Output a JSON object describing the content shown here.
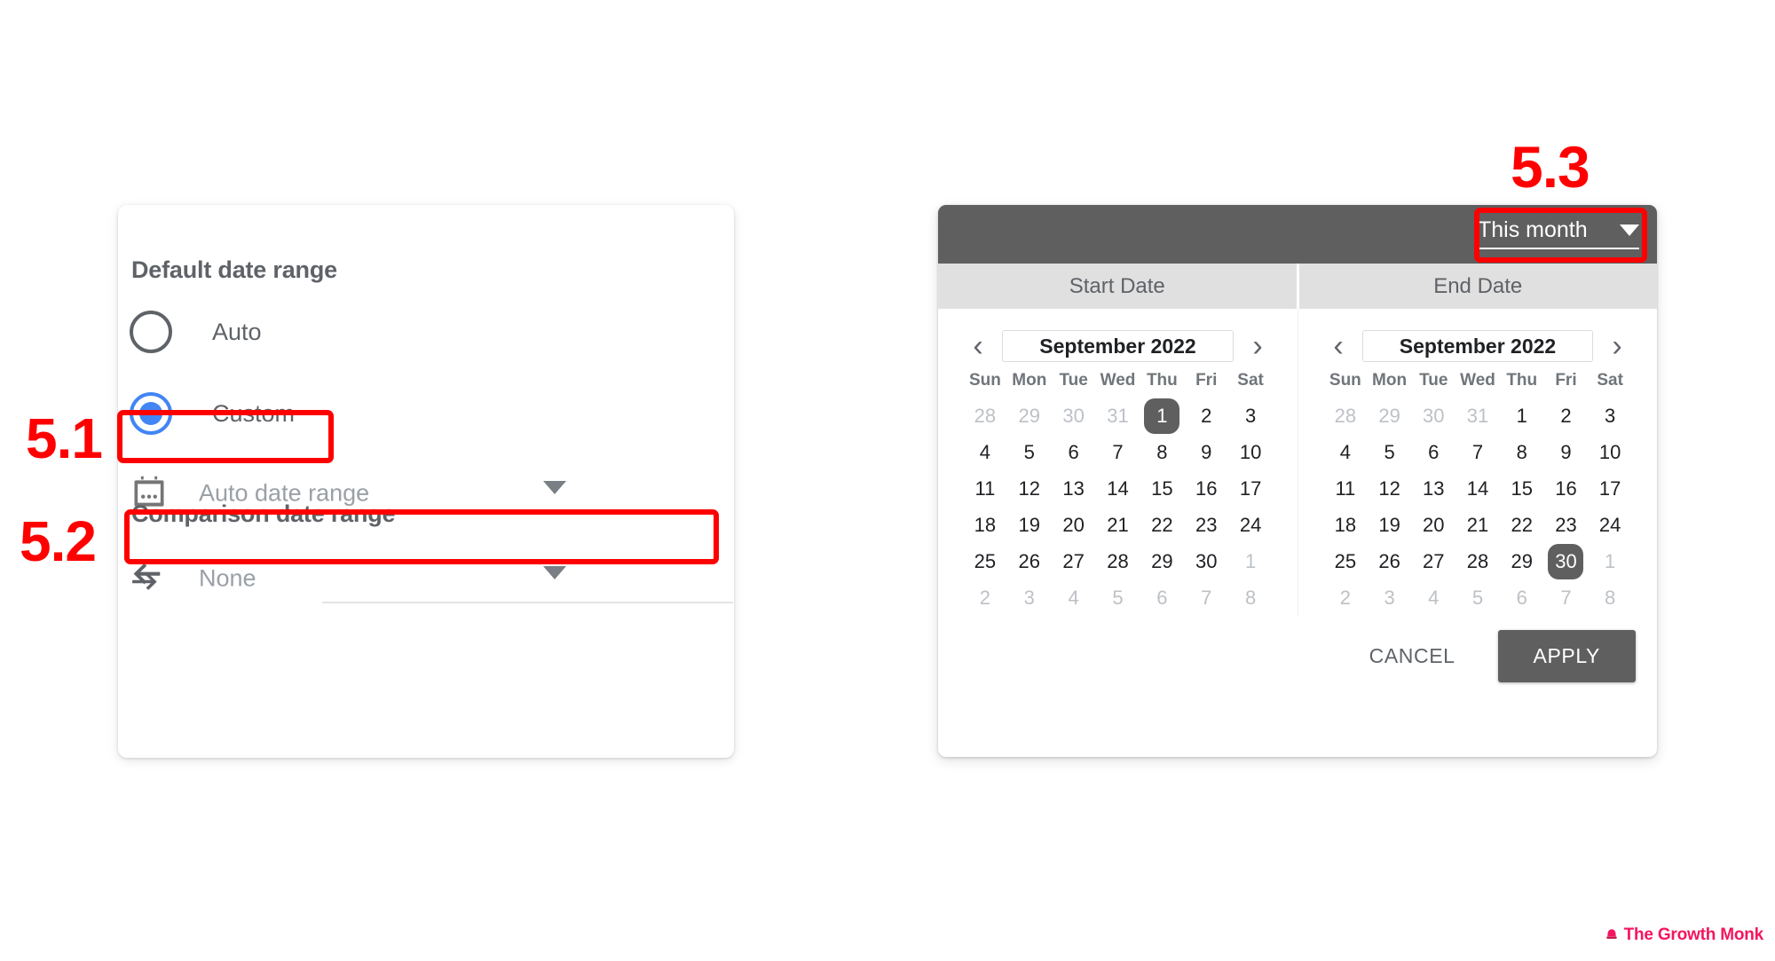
{
  "left_card": {
    "section_title_default": "Default date range",
    "section_title_comparison": "Comparison date range",
    "radio_auto_label": "Auto",
    "radio_custom_label": "Custom",
    "date_range_field_value": "Auto date range",
    "comparison_field_value": "None",
    "radio_selected": "Custom",
    "accent_color": "#4285f4",
    "text_color": "#5f6368"
  },
  "right_panel": {
    "preset_label": "This month",
    "tab_start": "Start Date",
    "tab_end": "End Date",
    "cancel_label": "CANCEL",
    "apply_label": "APPLY",
    "header_color": "#5f5f5f",
    "tab_bg_color": "#e0e0e0",
    "start_calendar": {
      "month_label": "September 2022",
      "prev_icon": "chevron-left-icon",
      "next_icon": "chevron-right-icon",
      "dow": [
        "Sun",
        "Mon",
        "Tue",
        "Wed",
        "Thu",
        "Fri",
        "Sat"
      ],
      "weeks": [
        [
          {
            "d": "28",
            "muted": true
          },
          {
            "d": "29",
            "muted": true
          },
          {
            "d": "30",
            "muted": true
          },
          {
            "d": "31",
            "muted": true
          },
          {
            "d": "1",
            "sel": true
          },
          {
            "d": "2"
          },
          {
            "d": "3"
          }
        ],
        [
          {
            "d": "4"
          },
          {
            "d": "5"
          },
          {
            "d": "6"
          },
          {
            "d": "7"
          },
          {
            "d": "8"
          },
          {
            "d": "9"
          },
          {
            "d": "10"
          }
        ],
        [
          {
            "d": "11"
          },
          {
            "d": "12"
          },
          {
            "d": "13"
          },
          {
            "d": "14"
          },
          {
            "d": "15"
          },
          {
            "d": "16"
          },
          {
            "d": "17"
          }
        ],
        [
          {
            "d": "18"
          },
          {
            "d": "19"
          },
          {
            "d": "20"
          },
          {
            "d": "21"
          },
          {
            "d": "22"
          },
          {
            "d": "23"
          },
          {
            "d": "24"
          }
        ],
        [
          {
            "d": "25"
          },
          {
            "d": "26"
          },
          {
            "d": "27"
          },
          {
            "d": "28"
          },
          {
            "d": "29"
          },
          {
            "d": "30"
          },
          {
            "d": "1",
            "muted": true
          }
        ],
        [
          {
            "d": "2",
            "muted": true
          },
          {
            "d": "3",
            "muted": true
          },
          {
            "d": "4",
            "muted": true
          },
          {
            "d": "5",
            "muted": true
          },
          {
            "d": "6",
            "muted": true
          },
          {
            "d": "7",
            "muted": true
          },
          {
            "d": "8",
            "muted": true
          }
        ]
      ],
      "selected_day": "1"
    },
    "end_calendar": {
      "month_label": "September 2022",
      "prev_icon": "chevron-left-icon",
      "next_icon": "chevron-right-icon",
      "dow": [
        "Sun",
        "Mon",
        "Tue",
        "Wed",
        "Thu",
        "Fri",
        "Sat"
      ],
      "weeks": [
        [
          {
            "d": "28",
            "muted": true
          },
          {
            "d": "29",
            "muted": true
          },
          {
            "d": "30",
            "muted": true
          },
          {
            "d": "31",
            "muted": true
          },
          {
            "d": "1"
          },
          {
            "d": "2"
          },
          {
            "d": "3"
          }
        ],
        [
          {
            "d": "4"
          },
          {
            "d": "5"
          },
          {
            "d": "6"
          },
          {
            "d": "7"
          },
          {
            "d": "8"
          },
          {
            "d": "9"
          },
          {
            "d": "10"
          }
        ],
        [
          {
            "d": "11"
          },
          {
            "d": "12"
          },
          {
            "d": "13"
          },
          {
            "d": "14"
          },
          {
            "d": "15"
          },
          {
            "d": "16"
          },
          {
            "d": "17"
          }
        ],
        [
          {
            "d": "18"
          },
          {
            "d": "19"
          },
          {
            "d": "20"
          },
          {
            "d": "21"
          },
          {
            "d": "22"
          },
          {
            "d": "23"
          },
          {
            "d": "24"
          }
        ],
        [
          {
            "d": "25"
          },
          {
            "d": "26"
          },
          {
            "d": "27"
          },
          {
            "d": "28"
          },
          {
            "d": "29"
          },
          {
            "d": "30",
            "sel": true
          },
          {
            "d": "1",
            "muted": true
          }
        ],
        [
          {
            "d": "2",
            "muted": true
          },
          {
            "d": "3",
            "muted": true
          },
          {
            "d": "4",
            "muted": true
          },
          {
            "d": "5",
            "muted": true
          },
          {
            "d": "6",
            "muted": true
          },
          {
            "d": "7",
            "muted": true
          },
          {
            "d": "8",
            "muted": true
          }
        ]
      ],
      "selected_day": "30"
    }
  },
  "annotations": {
    "step_51": "5.1",
    "step_52": "5.2",
    "step_53": "5.3",
    "color": "#ff0000"
  },
  "watermark": {
    "text": "The Growth Monk",
    "color": "#f5155e"
  }
}
